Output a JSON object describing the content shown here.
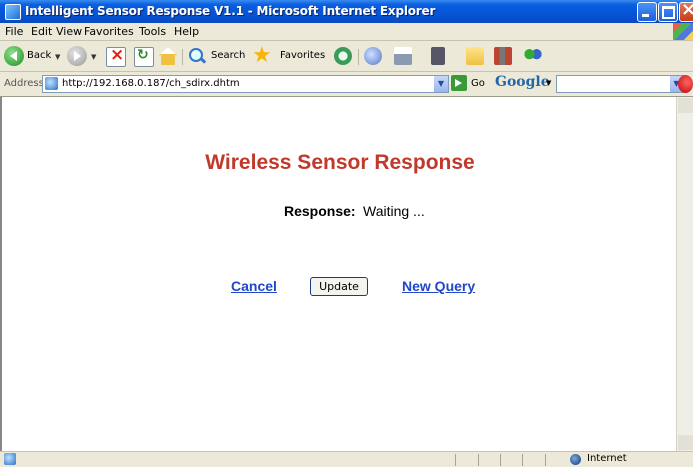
{
  "window": {
    "title": "Intelligent Sensor Response V1.1 - Microsoft Internet Explorer"
  },
  "menu": {
    "items": [
      "File",
      "Edit",
      "View",
      "Favorites",
      "Tools",
      "Help"
    ]
  },
  "toolbar": {
    "back_label": "Back",
    "search_label": "Search",
    "favorites_label": "Favorites"
  },
  "address": {
    "label": "Address",
    "url": "http://192.168.0.187/ch_sdirx.dhtm",
    "go_label": "Go",
    "google_label": "Google"
  },
  "page": {
    "title": "Wireless Sensor Response",
    "response_label": "Response:",
    "response_value": "Waiting ...",
    "cancel_link": "Cancel",
    "update_button": "Update",
    "new_query_link": "New Query",
    "title_color": "#c0392b",
    "link_color": "#1f47c7"
  },
  "status": {
    "zone": "Internet"
  }
}
